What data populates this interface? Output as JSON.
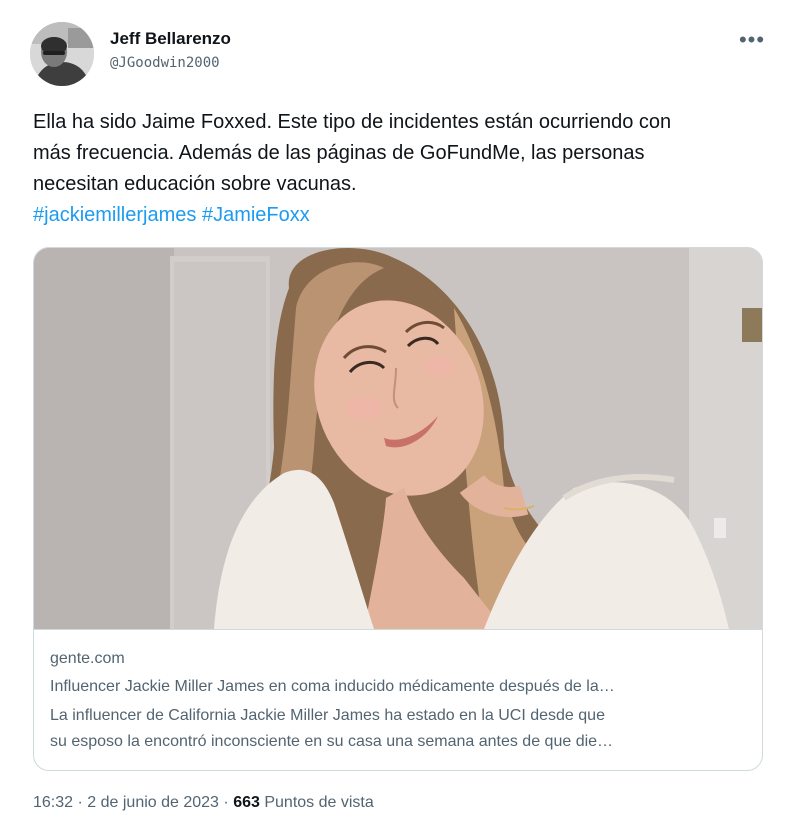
{
  "author": {
    "name": "Jeff Bellarenzo",
    "handle": "@JGoodwin2000"
  },
  "more_icon": "more-horizontal-icon",
  "tweet": {
    "lines": [
      "Ella ha sido Jaime Foxxed. Este tipo de incidentes están ocurriendo con",
      "más frecuencia. Además de las páginas de GoFundMe, las personas",
      "necesitan educación sobre vacunas."
    ],
    "hashtags": [
      "#jackiemillerjames",
      "#JamieFoxx"
    ]
  },
  "card": {
    "domain": "gente.com",
    "title": "Influencer Jackie Miller James en coma inducido médicamente después de la…",
    "description_lines": [
      "La influencer de California Jackie Miller James ha estado en la UCI desde que",
      "su esposo la encontró inconsciente en su casa una semana antes de que die…"
    ]
  },
  "meta": {
    "time": "16:32",
    "separator": "·",
    "date": "2 de junio de 2023",
    "views_count": "663",
    "views_label": "Puntos de vista"
  },
  "colors": {
    "text": "#0f1419",
    "secondary": "#536471",
    "link": "#1d9bf0",
    "border": "#cfd9de"
  }
}
